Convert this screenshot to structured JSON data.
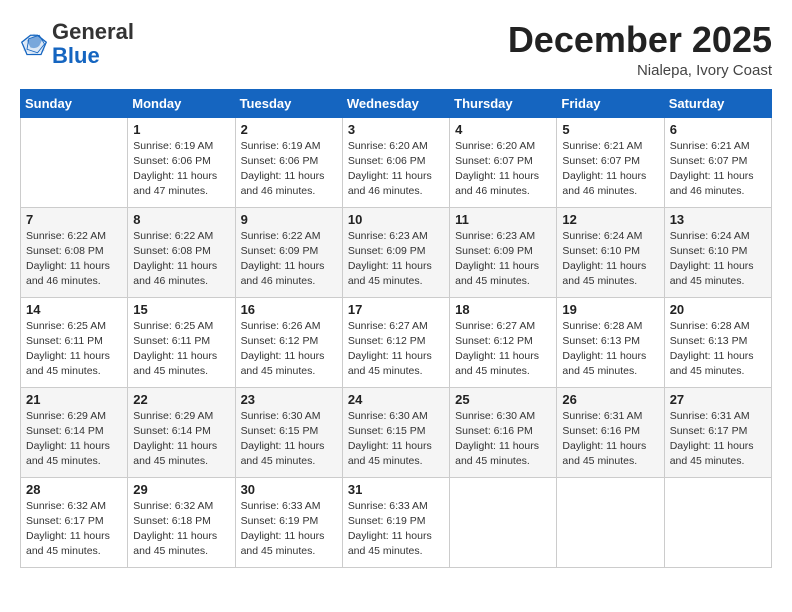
{
  "header": {
    "logo_general": "General",
    "logo_blue": "Blue",
    "month_title": "December 2025",
    "location": "Nialepa, Ivory Coast"
  },
  "weekdays": [
    "Sunday",
    "Monday",
    "Tuesday",
    "Wednesday",
    "Thursday",
    "Friday",
    "Saturday"
  ],
  "weeks": [
    [
      {
        "day": "",
        "info": ""
      },
      {
        "day": "1",
        "info": "Sunrise: 6:19 AM\nSunset: 6:06 PM\nDaylight: 11 hours\nand 47 minutes."
      },
      {
        "day": "2",
        "info": "Sunrise: 6:19 AM\nSunset: 6:06 PM\nDaylight: 11 hours\nand 46 minutes."
      },
      {
        "day": "3",
        "info": "Sunrise: 6:20 AM\nSunset: 6:06 PM\nDaylight: 11 hours\nand 46 minutes."
      },
      {
        "day": "4",
        "info": "Sunrise: 6:20 AM\nSunset: 6:07 PM\nDaylight: 11 hours\nand 46 minutes."
      },
      {
        "day": "5",
        "info": "Sunrise: 6:21 AM\nSunset: 6:07 PM\nDaylight: 11 hours\nand 46 minutes."
      },
      {
        "day": "6",
        "info": "Sunrise: 6:21 AM\nSunset: 6:07 PM\nDaylight: 11 hours\nand 46 minutes."
      }
    ],
    [
      {
        "day": "7",
        "info": "Sunrise: 6:22 AM\nSunset: 6:08 PM\nDaylight: 11 hours\nand 46 minutes."
      },
      {
        "day": "8",
        "info": "Sunrise: 6:22 AM\nSunset: 6:08 PM\nDaylight: 11 hours\nand 46 minutes."
      },
      {
        "day": "9",
        "info": "Sunrise: 6:22 AM\nSunset: 6:09 PM\nDaylight: 11 hours\nand 46 minutes."
      },
      {
        "day": "10",
        "info": "Sunrise: 6:23 AM\nSunset: 6:09 PM\nDaylight: 11 hours\nand 45 minutes."
      },
      {
        "day": "11",
        "info": "Sunrise: 6:23 AM\nSunset: 6:09 PM\nDaylight: 11 hours\nand 45 minutes."
      },
      {
        "day": "12",
        "info": "Sunrise: 6:24 AM\nSunset: 6:10 PM\nDaylight: 11 hours\nand 45 minutes."
      },
      {
        "day": "13",
        "info": "Sunrise: 6:24 AM\nSunset: 6:10 PM\nDaylight: 11 hours\nand 45 minutes."
      }
    ],
    [
      {
        "day": "14",
        "info": "Sunrise: 6:25 AM\nSunset: 6:11 PM\nDaylight: 11 hours\nand 45 minutes."
      },
      {
        "day": "15",
        "info": "Sunrise: 6:25 AM\nSunset: 6:11 PM\nDaylight: 11 hours\nand 45 minutes."
      },
      {
        "day": "16",
        "info": "Sunrise: 6:26 AM\nSunset: 6:12 PM\nDaylight: 11 hours\nand 45 minutes."
      },
      {
        "day": "17",
        "info": "Sunrise: 6:27 AM\nSunset: 6:12 PM\nDaylight: 11 hours\nand 45 minutes."
      },
      {
        "day": "18",
        "info": "Sunrise: 6:27 AM\nSunset: 6:12 PM\nDaylight: 11 hours\nand 45 minutes."
      },
      {
        "day": "19",
        "info": "Sunrise: 6:28 AM\nSunset: 6:13 PM\nDaylight: 11 hours\nand 45 minutes."
      },
      {
        "day": "20",
        "info": "Sunrise: 6:28 AM\nSunset: 6:13 PM\nDaylight: 11 hours\nand 45 minutes."
      }
    ],
    [
      {
        "day": "21",
        "info": "Sunrise: 6:29 AM\nSunset: 6:14 PM\nDaylight: 11 hours\nand 45 minutes."
      },
      {
        "day": "22",
        "info": "Sunrise: 6:29 AM\nSunset: 6:14 PM\nDaylight: 11 hours\nand 45 minutes."
      },
      {
        "day": "23",
        "info": "Sunrise: 6:30 AM\nSunset: 6:15 PM\nDaylight: 11 hours\nand 45 minutes."
      },
      {
        "day": "24",
        "info": "Sunrise: 6:30 AM\nSunset: 6:15 PM\nDaylight: 11 hours\nand 45 minutes."
      },
      {
        "day": "25",
        "info": "Sunrise: 6:30 AM\nSunset: 6:16 PM\nDaylight: 11 hours\nand 45 minutes."
      },
      {
        "day": "26",
        "info": "Sunrise: 6:31 AM\nSunset: 6:16 PM\nDaylight: 11 hours\nand 45 minutes."
      },
      {
        "day": "27",
        "info": "Sunrise: 6:31 AM\nSunset: 6:17 PM\nDaylight: 11 hours\nand 45 minutes."
      }
    ],
    [
      {
        "day": "28",
        "info": "Sunrise: 6:32 AM\nSunset: 6:17 PM\nDaylight: 11 hours\nand 45 minutes."
      },
      {
        "day": "29",
        "info": "Sunrise: 6:32 AM\nSunset: 6:18 PM\nDaylight: 11 hours\nand 45 minutes."
      },
      {
        "day": "30",
        "info": "Sunrise: 6:33 AM\nSunset: 6:19 PM\nDaylight: 11 hours\nand 45 minutes."
      },
      {
        "day": "31",
        "info": "Sunrise: 6:33 AM\nSunset: 6:19 PM\nDaylight: 11 hours\nand 45 minutes."
      },
      {
        "day": "",
        "info": ""
      },
      {
        "day": "",
        "info": ""
      },
      {
        "day": "",
        "info": ""
      }
    ]
  ]
}
